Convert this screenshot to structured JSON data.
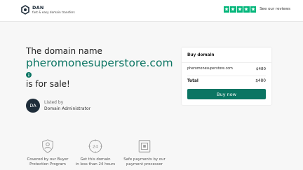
{
  "header": {
    "brand_name": "DAN",
    "brand_tagline": "fast & easy domain transfers",
    "reviews_label": "See our reviews",
    "rating_stars": 5,
    "star_color": "#00b67a"
  },
  "main": {
    "pre_title": "The domain name",
    "domain": "pheromonesuperstore.com",
    "post_title": "is for sale!",
    "accent_color": "#0b7563"
  },
  "listed_by": {
    "avatar_initials": "DA",
    "label": "Listed by",
    "name": "Domain Administrator"
  },
  "buy_card": {
    "title": "Buy domain",
    "domain": "pheromonesuperstore.com",
    "domain_price": "$480",
    "total_label": "Total",
    "total_price": "$480",
    "button_label": "Buy now"
  },
  "features": [
    {
      "icon": "shield-person-icon",
      "line1": "Covered by our Buyer",
      "line2": "Protection Program"
    },
    {
      "icon": "24-hour-clock-icon",
      "line1": "Get this domain",
      "line2": "in less than 24 hours"
    },
    {
      "icon": "secure-payment-icon",
      "line1": "Safe payments by our",
      "line2": "payment processor"
    }
  ]
}
